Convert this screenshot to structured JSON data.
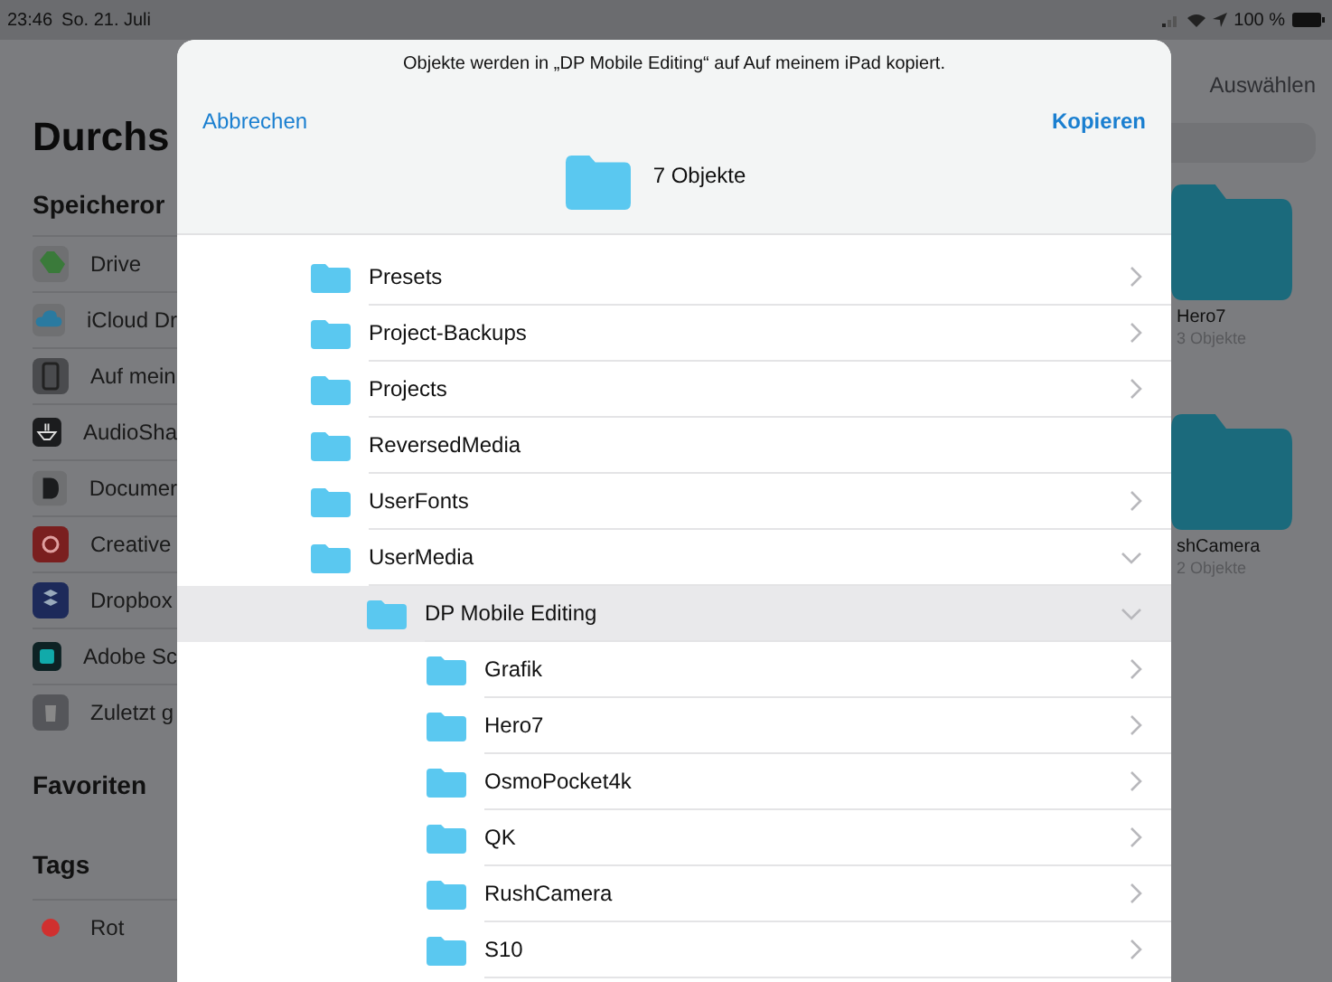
{
  "status_bar": {
    "time": "23:46",
    "date": "So. 21. Juli",
    "battery": "100 %"
  },
  "sidebar": {
    "title": "Durchs",
    "sections": [
      {
        "heading": "Speicheror",
        "items": [
          {
            "label": "Drive"
          },
          {
            "label": "iCloud Dr"
          },
          {
            "label": "Auf mein"
          },
          {
            "label": "AudioSha"
          },
          {
            "label": "Documer"
          },
          {
            "label": "Creative"
          },
          {
            "label": "Dropbox"
          },
          {
            "label": "Adobe Sc"
          },
          {
            "label": "Zuletzt g"
          }
        ]
      },
      {
        "heading": "Favoriten"
      },
      {
        "heading": "Tags",
        "items": [
          {
            "label": "Rot",
            "color": "#d0302f"
          }
        ]
      }
    ]
  },
  "browser": {
    "select_button": "Auswählen",
    "folders": [
      {
        "name": "Hero7",
        "count": "3 Objekte"
      },
      {
        "name": "shCamera",
        "count": "2 Objekte"
      }
    ]
  },
  "dialog": {
    "message": "Objekte werden in „DP Mobile Editing“ auf Auf meinem iPad kopiert.",
    "cancel": "Abbrechen",
    "confirm": "Kopieren",
    "summary": "7 Objekte",
    "tree": [
      {
        "name": "Presets",
        "expandable": true,
        "expanded": false,
        "selected": false
      },
      {
        "name": "Project-Backups",
        "expandable": true,
        "expanded": false,
        "selected": false
      },
      {
        "name": "Projects",
        "expandable": true,
        "expanded": false,
        "selected": false
      },
      {
        "name": "ReversedMedia",
        "expandable": false,
        "selected": false
      },
      {
        "name": "UserFonts",
        "expandable": true,
        "expanded": false,
        "selected": false
      },
      {
        "name": "UserMedia",
        "expandable": true,
        "expanded": true,
        "selected": false,
        "children": [
          {
            "name": "DP Mobile Editing",
            "expandable": true,
            "expanded": true,
            "selected": true,
            "children": [
              {
                "name": "Grafik",
                "expandable": true,
                "expanded": false,
                "selected": false
              },
              {
                "name": "Hero7",
                "expandable": true,
                "expanded": false,
                "selected": false
              },
              {
                "name": "OsmoPocket4k",
                "expandable": true,
                "expanded": false,
                "selected": false
              },
              {
                "name": "QK",
                "expandable": true,
                "expanded": false,
                "selected": false
              },
              {
                "name": "RushCamera",
                "expandable": true,
                "expanded": false,
                "selected": false
              },
              {
                "name": "S10",
                "expandable": true,
                "expanded": false,
                "selected": false
              }
            ]
          }
        ]
      }
    ]
  }
}
